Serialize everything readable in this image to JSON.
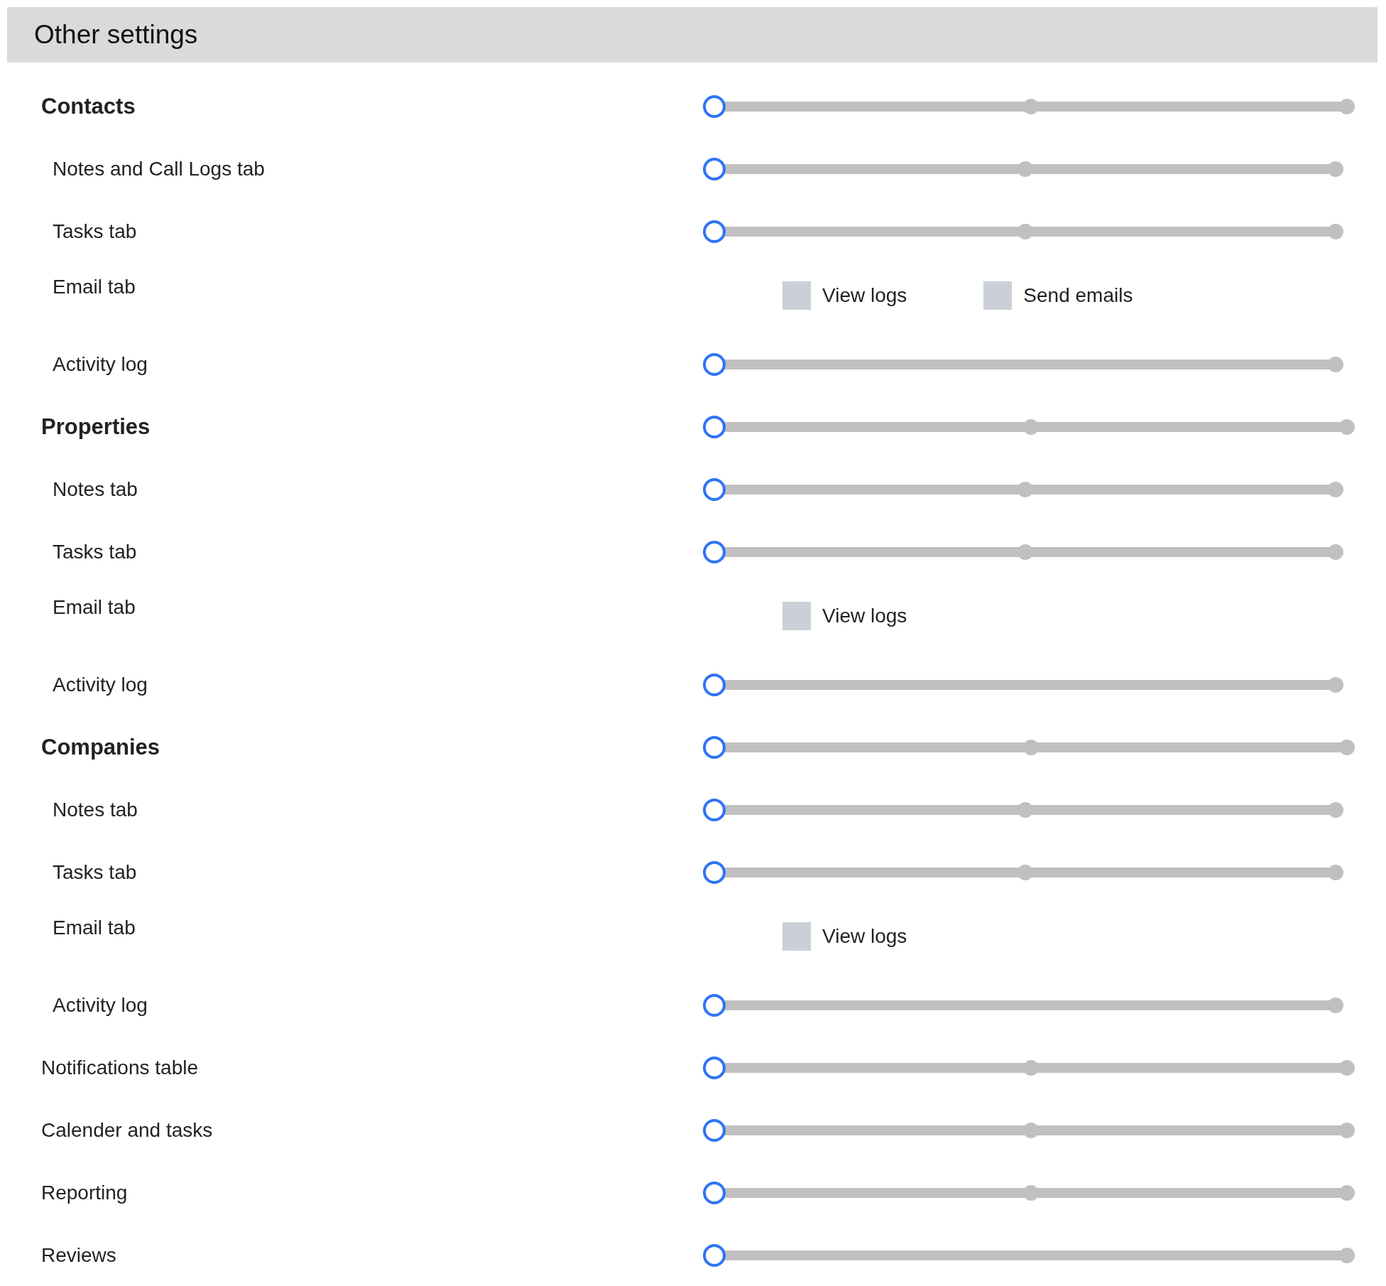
{
  "title": "Other settings",
  "rows": [
    {
      "label": "Contacts",
      "control": {
        "kind": "three-step",
        "level": 0
      },
      "children": [
        {
          "label": "Notes and Call Logs tab",
          "control": {
            "kind": "three-step",
            "level": 0
          }
        },
        {
          "label": "Tasks tab",
          "control": {
            "kind": "three-step",
            "level": 0
          }
        },
        {
          "label": "Email tab",
          "control": {
            "kind": "checkboxes",
            "options": [
              {
                "label": "View logs",
                "checked": false
              },
              {
                "label": "Send emails",
                "checked": false
              }
            ]
          }
        },
        {
          "label": "Activity log",
          "control": {
            "kind": "two-step",
            "level": 0
          }
        }
      ]
    },
    {
      "label": "Properties",
      "control": {
        "kind": "three-step",
        "level": 0
      },
      "children": [
        {
          "label": "Notes tab",
          "control": {
            "kind": "three-step",
            "level": 0
          }
        },
        {
          "label": "Tasks tab",
          "control": {
            "kind": "three-step",
            "level": 0
          }
        },
        {
          "label": "Email tab",
          "control": {
            "kind": "checkboxes",
            "options": [
              {
                "label": "View logs",
                "checked": false
              }
            ]
          }
        },
        {
          "label": "Activity log",
          "control": {
            "kind": "two-step",
            "level": 0
          }
        }
      ]
    },
    {
      "label": "Companies",
      "control": {
        "kind": "three-step",
        "level": 0
      },
      "children": [
        {
          "label": "Notes tab",
          "control": {
            "kind": "three-step",
            "level": 0
          }
        },
        {
          "label": "Tasks tab",
          "control": {
            "kind": "three-step",
            "level": 0
          }
        },
        {
          "label": "Email tab",
          "control": {
            "kind": "checkboxes",
            "options": [
              {
                "label": "View logs",
                "checked": false
              }
            ]
          }
        },
        {
          "label": "Activity log",
          "control": {
            "kind": "two-step",
            "level": 0
          }
        }
      ]
    },
    {
      "label": "Notifications table",
      "control": {
        "kind": "three-step",
        "level": 0
      }
    },
    {
      "label": "Calender and tasks",
      "control": {
        "kind": "three-step",
        "level": 0
      }
    },
    {
      "label": "Reporting",
      "control": {
        "kind": "three-step",
        "level": 0
      }
    },
    {
      "label": "Reviews",
      "control": {
        "kind": "two-step",
        "level": 0
      }
    }
  ]
}
